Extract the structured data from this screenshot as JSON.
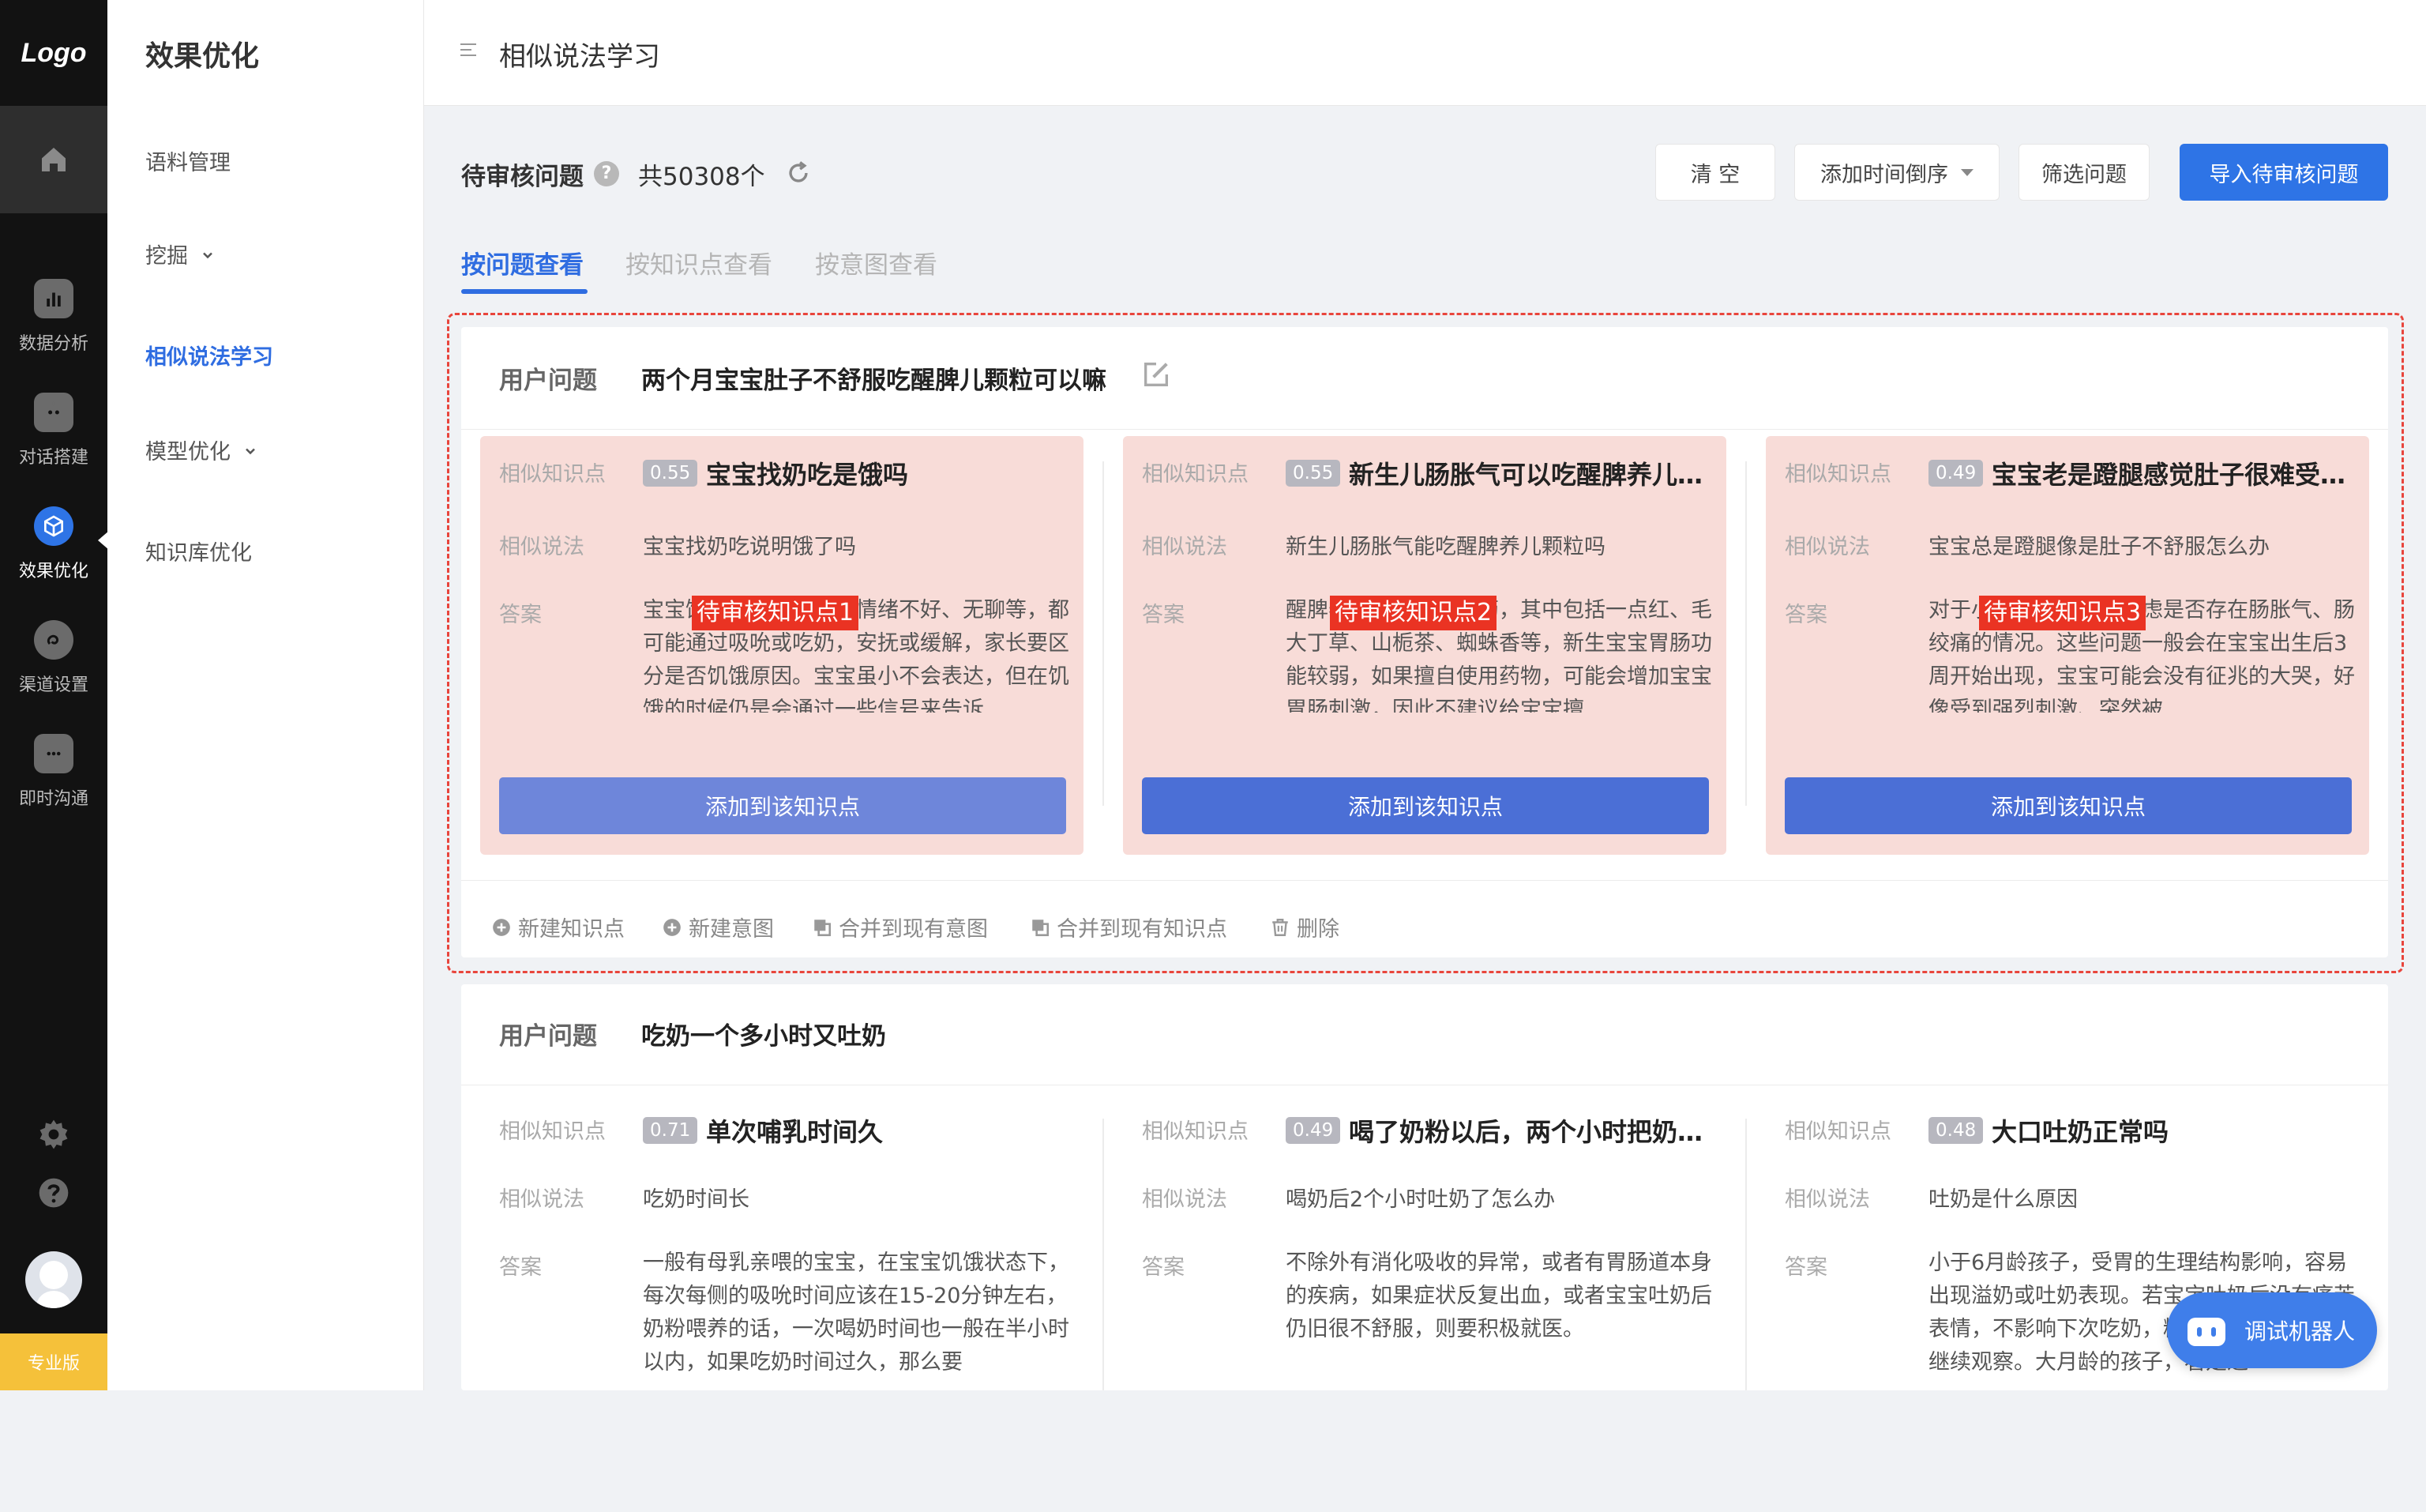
{
  "sidebar": {
    "logo": "Logo",
    "items": [
      {
        "label": "数据分析",
        "icon": "bar-chart-icon"
      },
      {
        "label": "对话搭建",
        "icon": "robot-icon"
      },
      {
        "label": "效果优化",
        "icon": "cube-icon",
        "active": true
      },
      {
        "label": "渠道设置",
        "icon": "channel-icon"
      },
      {
        "label": "即时沟通",
        "icon": "chat-icon"
      }
    ],
    "badge": "专业版"
  },
  "subnav": {
    "title": "效果优化",
    "items": [
      "语料管理",
      "挖掘",
      "相似说法学习",
      "模型优化",
      "知识库优化"
    ]
  },
  "topbar": {
    "title": "相似说法学习"
  },
  "toolbar": {
    "title": "待审核问题",
    "help": "?",
    "count": "共50308个",
    "clear_label": "清 空",
    "sort_label": "添加时间倒序",
    "filter_label": "筛选问题",
    "import_label": "导入待审核问题"
  },
  "tabs": [
    "按问题查看",
    "按知识点查看",
    "按意图查看"
  ],
  "labels": {
    "user_question": "用户问题",
    "similar_point": "相似知识点",
    "similar_phrase": "相似说法",
    "answer": "答案",
    "add_button": "添加到该知识点"
  },
  "questions": [
    {
      "question": "两个月宝宝肚子不舒服吃醒脾儿颗粒可以嘛",
      "candidates": [
        {
          "score": "0.55",
          "title": "宝宝找奶吃是饿吗",
          "phrase": "宝宝找奶吃说明饿了吗",
          "answer": "宝宝饿了，可能会出现情绪不好、无聊等，都可能通过吸吮或吃奶，安抚或缓解，家长要区分是否饥饿原因。宝宝虽小不会表达，但在饥饿的时候仍是会通过一些信号来告诉",
          "tag": "待审核知识点1"
        },
        {
          "score": "0.55",
          "title": "新生儿肠胀气可以吃醒脾养儿颗粒吗",
          "phrase": "新生儿肠胀气能吃醒脾养儿颗粒吗",
          "answer": "醒脾养儿颗粒是中成药，其中包括一点红、毛大丁草、山栀茶、蜘蛛香等，新生宝宝胃肠功能较弱，如果擅自使用药物，可能会增加宝宝胃肠刺激，因此不建议给宝宝擅",
          "tag": "待审核知识点2"
        },
        {
          "score": "0.49",
          "title": "宝宝老是蹬腿感觉肚子很难受怎么办",
          "phrase": "宝宝总是蹬腿像是肚子不舒服怎么办",
          "answer": "对于小宝宝，最先要考虑是否存在肠胀气、肠绞痛的情况。这些问题一般会在宝宝出生后3周开始出现，宝宝可能会没有征兆的大哭，好像受到强烈刺激、突然被",
          "tag": "待审核知识点3"
        }
      ],
      "actions": [
        "新建知识点",
        "新建意图",
        "合并到现有意图",
        "合并到现有知识点",
        "删除"
      ]
    },
    {
      "question": "吃奶一个多小时又吐奶",
      "candidates": [
        {
          "score": "0.71",
          "title": "单次哺乳时间久",
          "phrase": "吃奶时间长",
          "answer": "一般有母乳亲喂的宝宝，在宝宝饥饿状态下，每次每侧的吸吮时间应该在15-20分钟左右，奶粉喂养的话，一次喝奶时间也一般在半小时以内，如果吃奶时间过久，那么要"
        },
        {
          "score": "0.49",
          "title": "喝了奶粉以后，两个小时把奶吐了",
          "phrase": "喝奶后2个小时吐奶了怎么办",
          "answer": "不除外有消化吸收的异常，或者有胃肠道本身的疾病，如果症状反复出血，或者宝宝吐奶后仍旧很不舒服，则要积极就医。"
        },
        {
          "score": "0.48",
          "title": "大口吐奶正常吗",
          "phrase": "吐奶是什么原因",
          "answer": "小于6月龄孩子，受胃的生理结构影响，容易出现溢奶或吐奶表现。若宝宝吐奶后没有痛苦表情，不影响下次吃奶，精神状态良好，可以继续观察。大月龄的孩子，看是进"
        }
      ]
    }
  ],
  "bot": {
    "label": "调试机器人"
  },
  "colors": {
    "accent": "#2e74e6",
    "highlight_bg": "#f8dcd8",
    "tag_red": "#ea3323",
    "selection_border": "#e8453c"
  }
}
